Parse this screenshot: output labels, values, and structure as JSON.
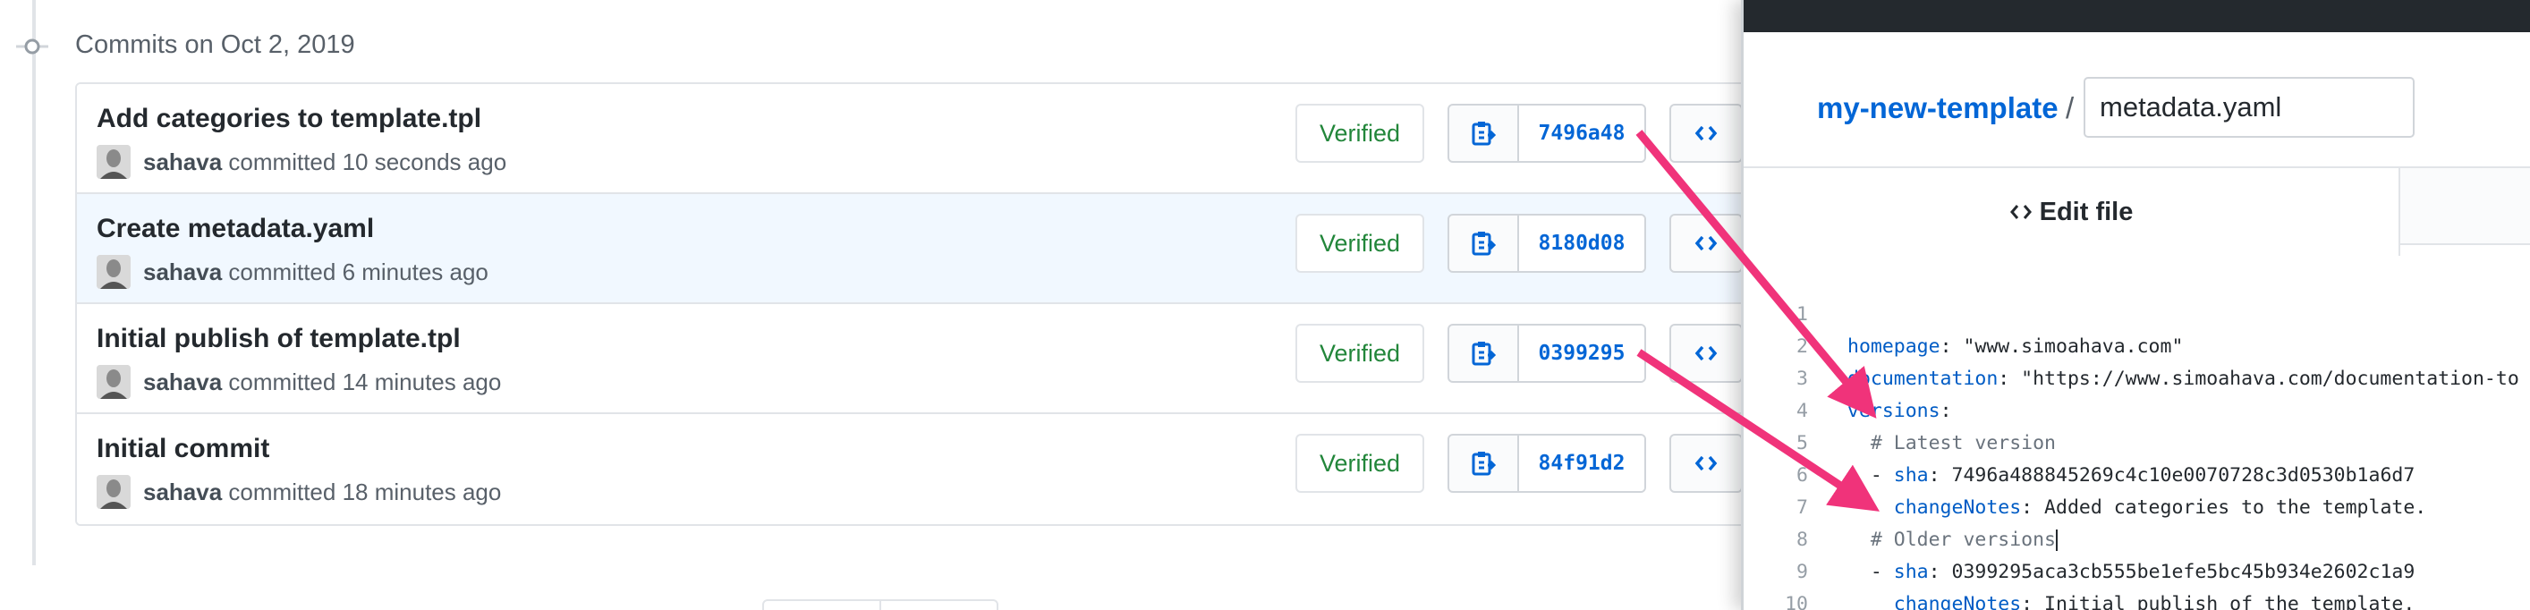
{
  "commits_group": {
    "date_header": "Commits on Oct 2, 2019",
    "commits": [
      {
        "title": "Add categories to template.tpl",
        "author": "sahava",
        "time": "committed 10 seconds ago",
        "verified": "Verified",
        "sha": "7496a48",
        "highlighted": false
      },
      {
        "title": "Create metadata.yaml",
        "author": "sahava",
        "time": "committed 6 minutes ago",
        "verified": "Verified",
        "sha": "8180d08",
        "highlighted": true
      },
      {
        "title": "Initial publish of template.tpl",
        "author": "sahava",
        "time": "committed 14 minutes ago",
        "verified": "Verified",
        "sha": "0399295",
        "highlighted": false
      },
      {
        "title": "Initial commit",
        "author": "sahava",
        "time": "committed 18 minutes ago",
        "verified": "Verified",
        "sha": "84f91d2",
        "highlighted": false
      }
    ]
  },
  "editor": {
    "repo_name": "my-new-template",
    "path_separator": "/",
    "filename": "metadata.yaml",
    "edit_tab_label": "Edit file",
    "edit_tab_icon": "code-icon",
    "lines": [
      {
        "n": "1",
        "key": "homepage",
        "rest": ": \"www.simoahava.com\"",
        "indent": "",
        "comment": ""
      },
      {
        "n": "2",
        "key": "documentation",
        "rest": ": \"https://www.simoahava.com/documentation-to",
        "indent": "",
        "comment": ""
      },
      {
        "n": "3",
        "key": "versions",
        "rest": ":",
        "indent": "",
        "comment": ""
      },
      {
        "n": "4",
        "key": "",
        "rest": "",
        "indent": "  ",
        "comment": "# Latest version"
      },
      {
        "n": "5",
        "key": "sha",
        "rest": ": 7496a488845269c4c10e0070728c3d0530b1a6d7",
        "indent": "  - ",
        "comment": ""
      },
      {
        "n": "6",
        "key": "changeNotes",
        "rest": ": Added categories to the template.",
        "indent": "    ",
        "comment": ""
      },
      {
        "n": "7",
        "key": "",
        "rest": "",
        "indent": "  ",
        "comment": "# Older versions"
      },
      {
        "n": "8",
        "key": "sha",
        "rest": ": 0399295aca3cb555be1efe5bc45b934e2602c1a9",
        "indent": "  - ",
        "comment": ""
      },
      {
        "n": "9",
        "key": "changeNotes",
        "rest": ": Initial publish of the template.",
        "indent": "    ",
        "comment": ""
      },
      {
        "n": "10",
        "key": "",
        "rest": "",
        "indent": "",
        "comment": ""
      }
    ]
  },
  "colors": {
    "link_blue": "#0366d6",
    "verified_green": "#22863a",
    "arrow_pink": "#f0337a",
    "yaml_key": "#005cc5"
  }
}
